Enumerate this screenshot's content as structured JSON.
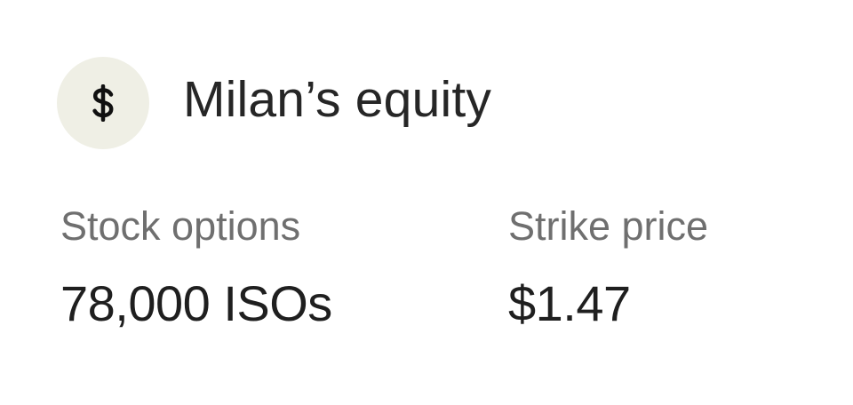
{
  "colors": {
    "icon_circle_bg": "#efefe5",
    "icon_glyph": "#111111",
    "label_text": "#6f6f6f",
    "value_text": "#1f1f1f"
  },
  "header": {
    "icon": "dollar-sign-icon",
    "title": "Milan’s equity"
  },
  "fields": [
    {
      "label": "Stock options",
      "value": "78,000 ISOs"
    },
    {
      "label": "Strike price",
      "value": "$1.47"
    }
  ]
}
